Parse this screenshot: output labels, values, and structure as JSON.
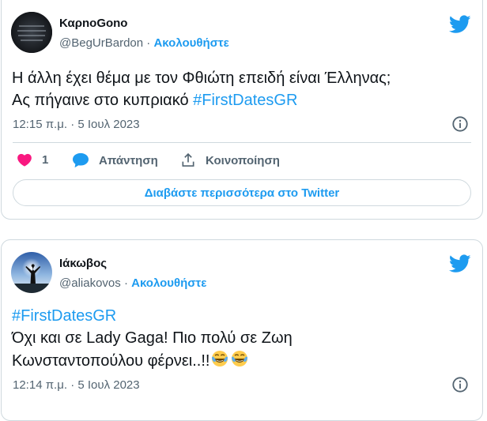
{
  "tweets": [
    {
      "author": {
        "name": "ΚαρnoGono",
        "handle": "@BegUrBardon",
        "separator": "·",
        "follow_label": "Ακολουθήστε",
        "avatar_icon": "dark-text-avatar"
      },
      "text": {
        "line1": "Η άλλη έχει θέμα με τον Φθιώτη επειδή είναι Έλληνας;",
        "line2_prefix": "Ας πήγαινε στο κυπριακό ",
        "line2_hashtag": "#FirstDatesGR"
      },
      "timestamp": "12:15 π.μ. · 5 Ιουλ 2023",
      "actions": {
        "like_count": "1",
        "reply_label": "Απάντηση",
        "share_label": "Κοινοποίηση"
      },
      "read_more_label": "Διαβάστε περισσότερα στο Twitter"
    },
    {
      "author": {
        "name": "Ιάκωβος",
        "handle": "@aliakovos",
        "separator": "·",
        "follow_label": "Ακολουθήστε",
        "avatar_icon": "sky-silhouette-avatar"
      },
      "text": {
        "line1_hashtag": "#FirstDatesGR",
        "line2": "Όχι και σε Lady Gaga! Πιο πολύ σε Ζωη",
        "line3": "Κωνσταντοπούλου φέρνει..!!",
        "emojis": [
          "tears-of-joy-emoji",
          "tears-of-joy-emoji"
        ]
      },
      "timestamp": "12:14 π.μ. · 5 Ιουλ 2023"
    }
  ],
  "colors": {
    "accent": "#1d9bf0",
    "like": "#f91880",
    "text": "#0f1419",
    "muted": "#536471",
    "border": "#cfd9de"
  }
}
